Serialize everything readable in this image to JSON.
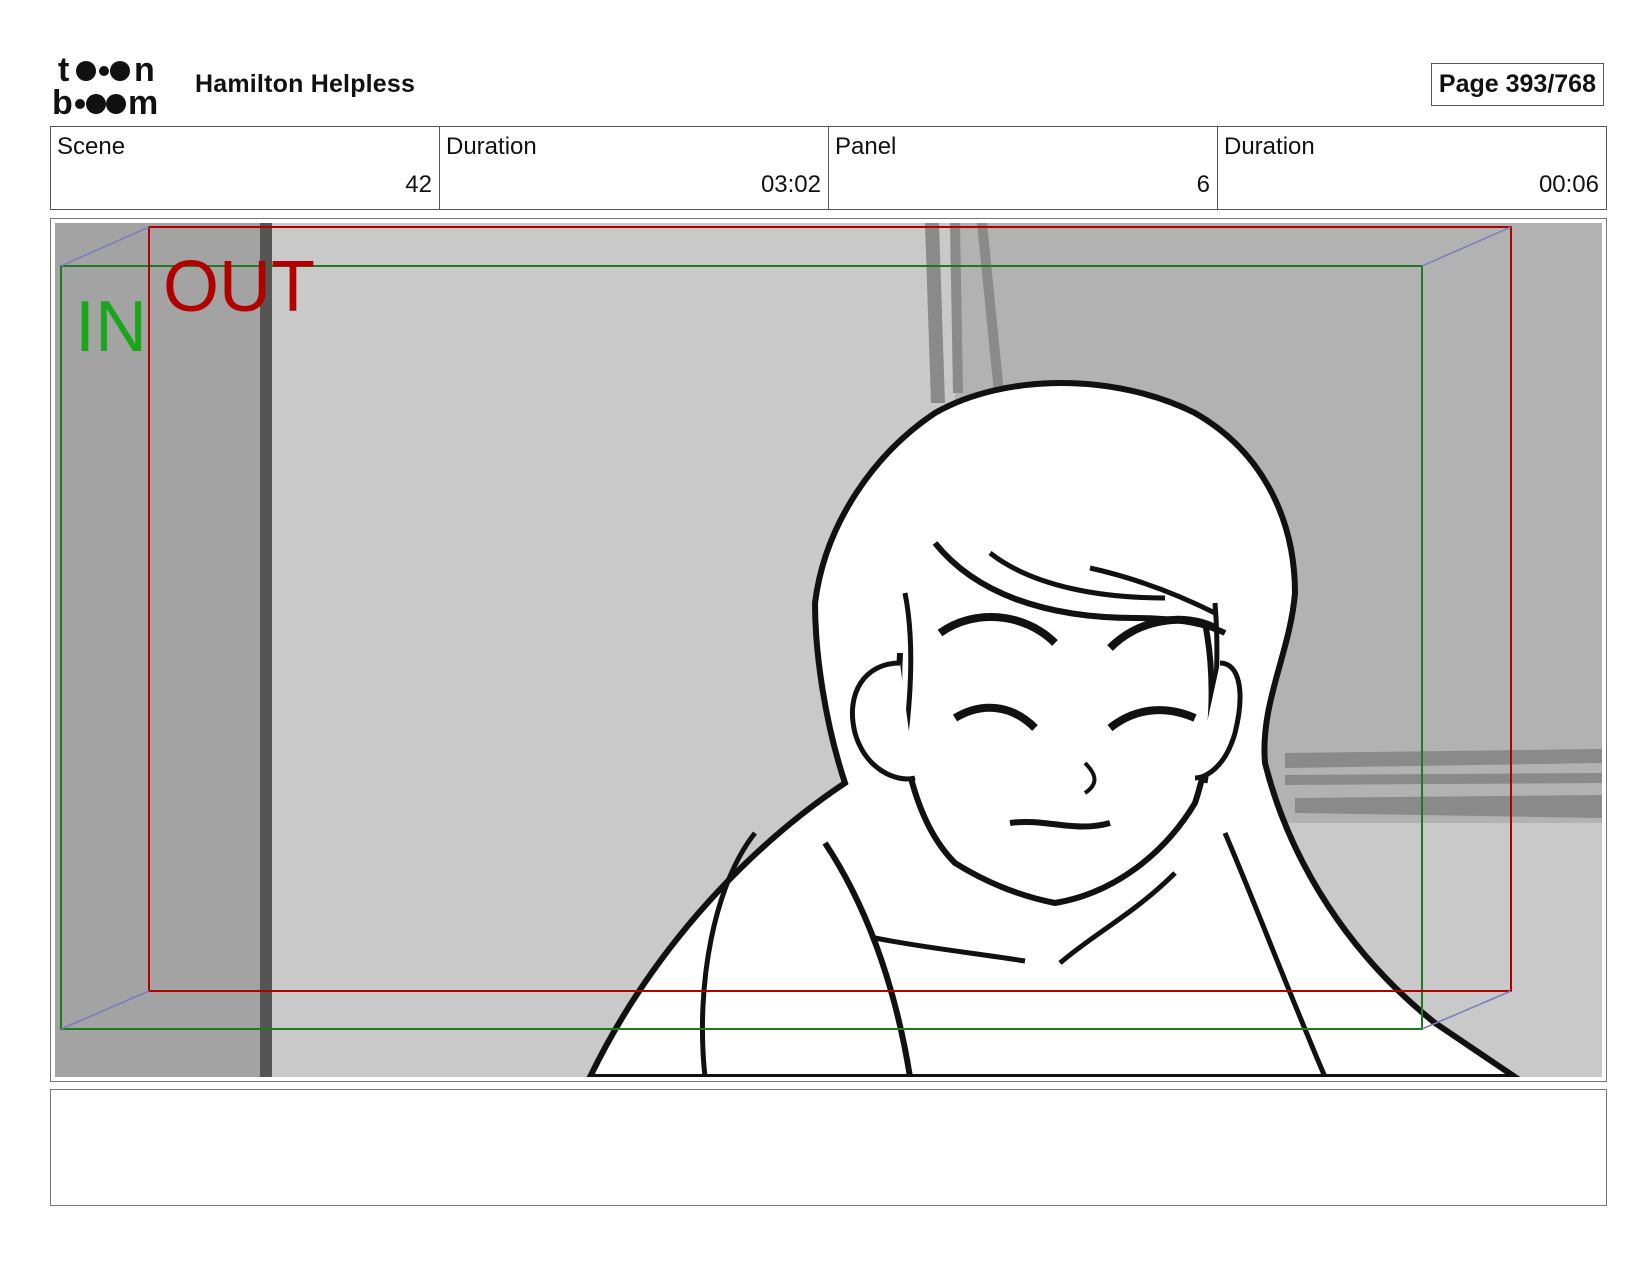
{
  "header": {
    "logo_name": "toon boom",
    "project_title": "Hamilton Helpless",
    "page_label": "Page 393/768"
  },
  "info": {
    "scene_label": "Scene",
    "scene_value": "42",
    "scene_duration_label": "Duration",
    "scene_duration_value": "03:02",
    "panel_label": "Panel",
    "panel_value": "6",
    "panel_duration_label": "Duration",
    "panel_duration_value": "00:06"
  },
  "panel": {
    "in_label": "IN",
    "out_label": "OUT",
    "in_color": "#1aa51a",
    "out_color": "#b00000"
  },
  "notes": {
    "text": ""
  }
}
